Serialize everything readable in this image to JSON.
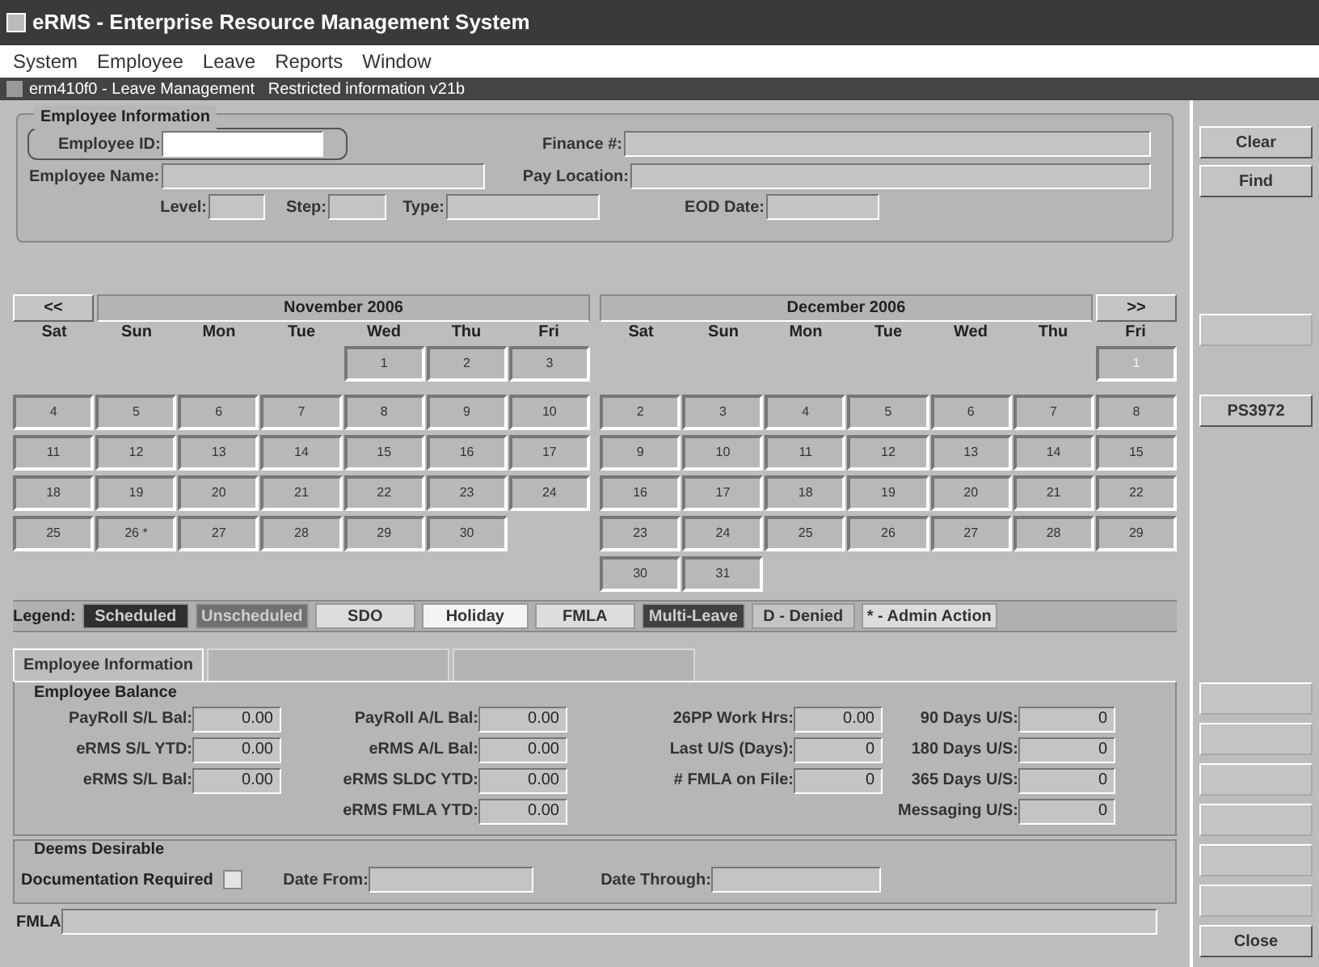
{
  "app_title": "eRMS - Enterprise Resource Management System",
  "menu": [
    "System",
    "Employee",
    "Leave",
    "Reports",
    "Window"
  ],
  "form_title": "erm410f0 - Leave Management   Restricted information v21b",
  "employee_info": {
    "legend": "Employee Information",
    "fields": [
      {
        "label": "Employee ID:",
        "focused": true
      },
      {
        "label": "Employee Name:",
        "focused": false
      },
      {
        "label": "Level:",
        "focused": false
      },
      {
        "label": "Step:",
        "focused": false
      },
      {
        "label": "Type:",
        "focused": false
      },
      {
        "label": "Finance #:",
        "focused": false
      },
      {
        "label": "Pay Location:",
        "focused": false
      },
      {
        "label": "EOD Date:",
        "focused": false
      }
    ]
  },
  "calendar": {
    "prev": "<<",
    "next": ">>",
    "months": [
      {
        "title": "November 2006",
        "days": [
          "Sat",
          "Sun",
          "Mon",
          "Tue",
          "Wed",
          "Thu",
          "Fri"
        ],
        "weeks": [
          [
            {
              "d": "1"
            },
            {
              "d": "2"
            },
            {
              "d": "3"
            }
          ],
          [
            {
              "d": "4"
            },
            {
              "d": "5"
            },
            {
              "d": "6"
            },
            {
              "d": "7"
            },
            {
              "d": "8"
            },
            {
              "d": "9"
            },
            {
              "d": "10"
            }
          ],
          [
            {
              "d": "11"
            },
            {
              "d": "12"
            },
            {
              "d": "13"
            },
            {
              "d": "14"
            },
            {
              "d": "15"
            },
            {
              "d": "16"
            },
            {
              "d": "17"
            }
          ],
          [
            {
              "d": "18"
            },
            {
              "d": "19"
            },
            {
              "d": "20"
            },
            {
              "d": "21"
            },
            {
              "d": "22"
            },
            {
              "d": "23"
            },
            {
              "d": "24"
            }
          ],
          [
            {
              "d": "25"
            },
            {
              "d": "26 *"
            },
            {
              "d": "27"
            },
            {
              "d": "28"
            },
            {
              "d": "29"
            },
            {
              "d": "30"
            }
          ]
        ]
      },
      {
        "title": "December 2006",
        "days": [
          "Sat",
          "Sun",
          "Mon",
          "Tue",
          "Wed",
          "Thu",
          "Fri"
        ],
        "weeks": [
          [
            {
              "d": "1",
              "disabled": true
            }
          ],
          [
            {
              "d": "2"
            },
            {
              "d": "3"
            },
            {
              "d": "4"
            },
            {
              "d": "5"
            },
            {
              "d": "6"
            },
            {
              "d": "7"
            },
            {
              "d": "8"
            }
          ],
          [
            {
              "d": "9"
            },
            {
              "d": "10"
            },
            {
              "d": "11"
            },
            {
              "d": "12"
            },
            {
              "d": "13"
            },
            {
              "d": "14"
            },
            {
              "d": "15"
            }
          ],
          [
            {
              "d": "16"
            },
            {
              "d": "17"
            },
            {
              "d": "18"
            },
            {
              "d": "19"
            },
            {
              "d": "20"
            },
            {
              "d": "21"
            },
            {
              "d": "22"
            }
          ],
          [
            {
              "d": "23"
            },
            {
              "d": "24"
            },
            {
              "d": "25"
            },
            {
              "d": "26"
            },
            {
              "d": "27"
            },
            {
              "d": "28"
            },
            {
              "d": "29"
            }
          ],
          [
            {
              "d": "30"
            },
            {
              "d": "31"
            }
          ]
        ]
      }
    ]
  },
  "legend": {
    "label": "Legend:",
    "items": [
      {
        "text": "Scheduled",
        "color": "#303030"
      },
      {
        "text": "Unscheduled",
        "color": "#707070"
      },
      {
        "text": "SDO",
        "color": "#dcdcdc"
      },
      {
        "text": "Holiday",
        "color": "#f4f4f4"
      },
      {
        "text": "FMLA",
        "color": "#dcdcdc"
      },
      {
        "text": "Multi-Leave",
        "color": "#404040"
      },
      {
        "text": "D - Denied",
        "color": "#c4c4c4"
      },
      {
        "text": "* - Admin Action",
        "color": "#dcdcdc"
      }
    ]
  },
  "tabs": [
    {
      "label": "Employee Information",
      "selected": true,
      "disabled": false
    },
    {
      "selected": false,
      "disabled": true
    },
    {
      "selected": false,
      "disabled": true
    }
  ],
  "balance": {
    "legend": "Employee Balance",
    "columns": [
      [
        {
          "label": "PayRoll S/L Bal:",
          "value": "0.00"
        },
        {
          "label": "eRMS S/L YTD:",
          "value": "0.00"
        },
        {
          "label": "eRMS S/L Bal:",
          "value": "0.00"
        }
      ],
      [
        {
          "label": "PayRoll A/L Bal:",
          "value": "0.00"
        },
        {
          "label": "eRMS A/L Bal:",
          "value": "0.00"
        },
        {
          "label": "eRMS SLDC YTD:",
          "value": "0.00"
        },
        {
          "label": "eRMS FMLA YTD:",
          "value": "0.00"
        }
      ],
      [
        {
          "label": "26PP Work Hrs:",
          "value": "0.00"
        },
        {
          "label": "Last U/S (Days):",
          "value": "0"
        },
        {
          "label": "# FMLA on File:",
          "value": "0"
        }
      ],
      [
        {
          "label": "90 Days U/S:",
          "value": "0"
        },
        {
          "label": "180 Days U/S:",
          "value": "0"
        },
        {
          "label": "365 Days U/S:",
          "value": "0"
        },
        {
          "label": "Messaging U/S:",
          "value": "0"
        }
      ]
    ]
  },
  "deems": {
    "legend": "Deems Desirable",
    "documentation_label": "Documentation Required",
    "documentation_checked": false,
    "date_from_label": "Date From:",
    "date_through_label": "Date Through:"
  },
  "fmla_label": "FMLA",
  "side_buttons": {
    "top": [
      {
        "label": "Clear",
        "disabled": false
      },
      {
        "label": "Find",
        "disabled": false
      }
    ],
    "middle": [
      {
        "disabled": true
      },
      {
        "label": "PS3972",
        "disabled": false
      }
    ],
    "bottom": [
      {
        "disabled": true
      },
      {
        "disabled": true
      },
      {
        "disabled": true
      },
      {
        "disabled": true
      },
      {
        "disabled": true
      },
      {
        "disabled": true
      },
      {
        "label": "Close",
        "disabled": false
      }
    ]
  }
}
